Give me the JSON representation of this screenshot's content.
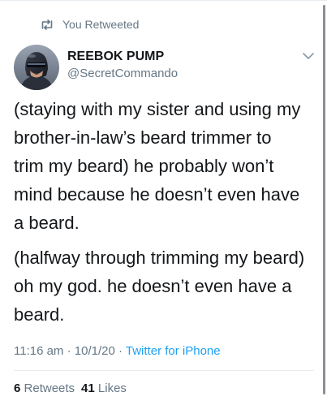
{
  "retweet": {
    "icon": "retweet-icon",
    "label": "You Retweeted"
  },
  "author": {
    "avatar": "robocop-avatar",
    "display_name": "REEBOK PUMP",
    "handle": "@SecretCommando"
  },
  "menu": {
    "icon": "chevron-down-icon"
  },
  "tweet": {
    "paragraph_1": "(staying with my sister and using my\nbrother-in-law’s beard trimmer to\ntrim my beard) he probably won’t\nmind because he doesn’t even have\na beard.",
    "paragraph_2": "(halfway through trimming my beard)\noh my god. he doesn’t even have a\nbeard."
  },
  "meta": {
    "time": "11:16 am",
    "separator_1": " · ",
    "date": "10/1/20",
    "separator_2": " · ",
    "source": "Twitter for iPhone"
  },
  "stats": {
    "retweets_count": "6",
    "retweets_label": "Retweets",
    "likes_count": "41",
    "likes_label": "Likes"
  },
  "colors": {
    "text_primary": "#14171a",
    "text_secondary": "#657786",
    "link": "#1da1f2",
    "divider": "#e6ecf0"
  }
}
